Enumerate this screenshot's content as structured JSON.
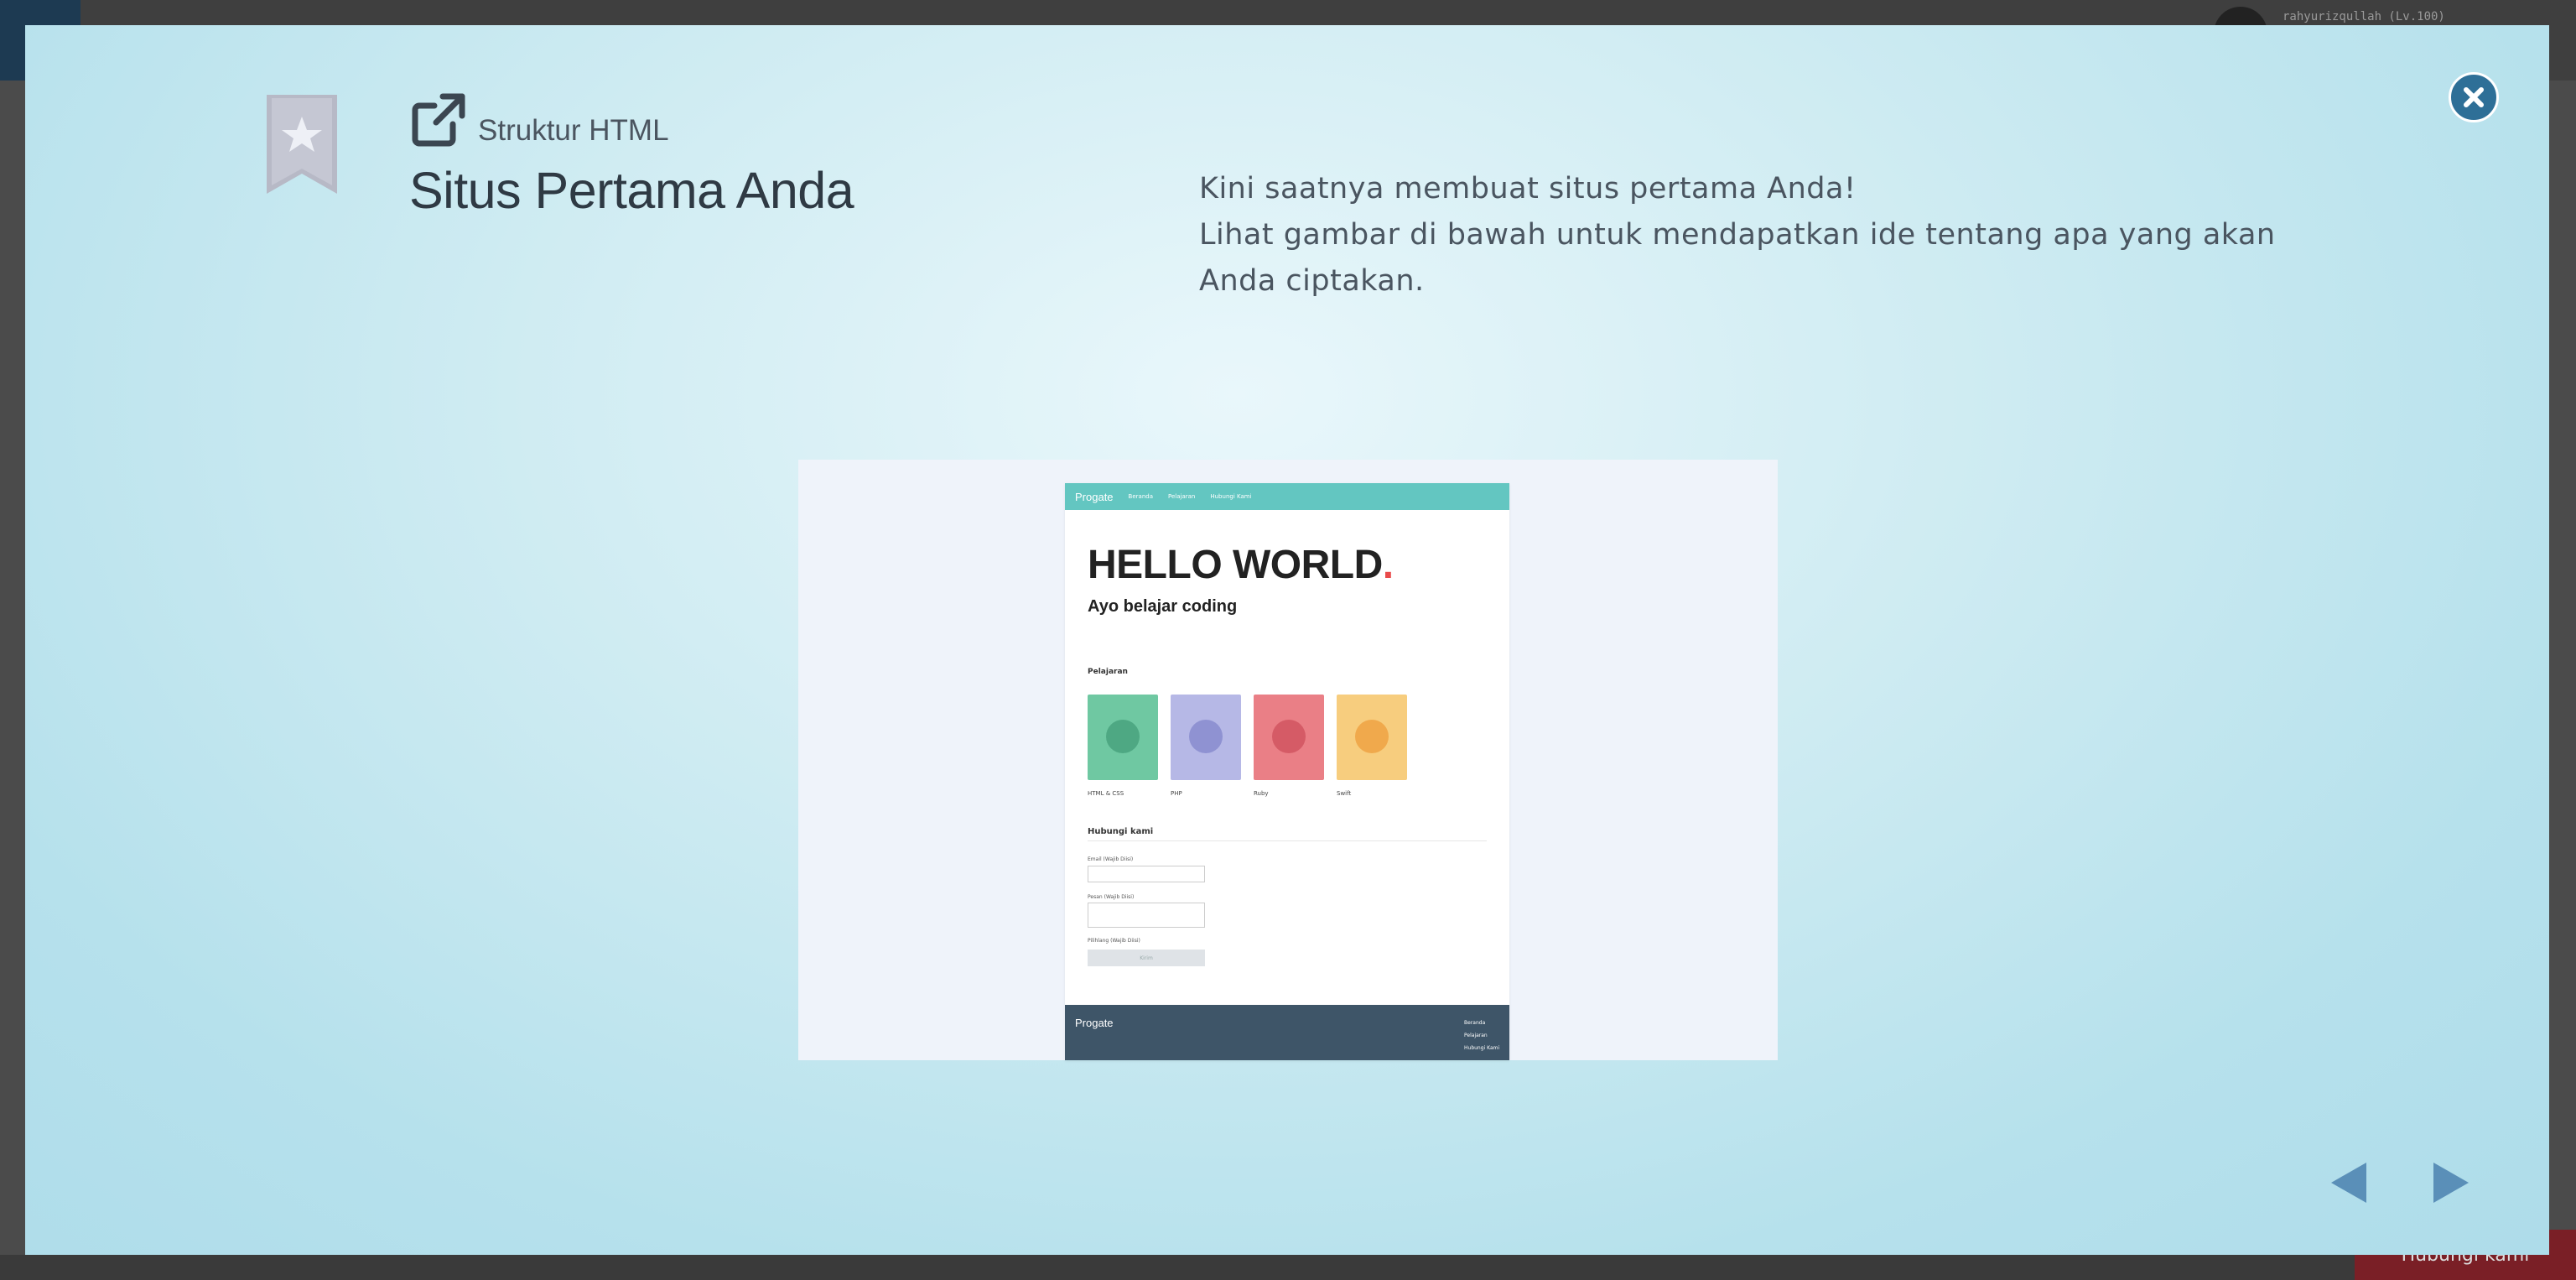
{
  "background": {
    "username": "rahyurizqullah (Lv.100)",
    "contact_button": "Hubungi kami"
  },
  "modal": {
    "subtitle": "Struktur HTML",
    "title": "Situs Pertama Anda",
    "description_line1": "Kini saatnya membuat situs pertama Anda!",
    "description_line2": "Lihat gambar di bawah untuk mendapatkan ide tentang apa yang akan Anda ciptakan.",
    "icons": {
      "bookmark": "bookmark-star-icon",
      "external": "external-link-icon",
      "close": "close-icon",
      "prev": "prev-arrow-icon",
      "next": "next-arrow-icon"
    }
  },
  "preview_site": {
    "logo": "Progate",
    "nav": [
      "Beranda",
      "Pelajaran",
      "Hubungi Kami"
    ],
    "hello": "HELLO WORLD",
    "hello_dot": ".",
    "tagline": "Ayo belajar coding",
    "lessons_heading": "Pelajaran",
    "lessons": [
      {
        "label": "HTML & CSS",
        "color": "#6fc8a2"
      },
      {
        "label": "PHP",
        "color": "#b6b8e6"
      },
      {
        "label": "Ruby",
        "color": "#ea7f86"
      },
      {
        "label": "Swift",
        "color": "#f7cd7e"
      }
    ],
    "contact_heading": "Hubungi kami",
    "fields": [
      "Email (Wajib Diisi)",
      "Pesan (Wajib Diisi)",
      "Pilihlang (Wajib Diisi)"
    ],
    "submit": "Kirim",
    "footer_logo": "Progate",
    "footer_links": [
      "Beranda",
      "Pelajaran",
      "Hubungi Kami"
    ]
  },
  "colors": {
    "accent": "#2e6f97",
    "header_teal": "#63c6c1",
    "footer_navy": "#3e5568",
    "arrow": "#5a8fb8"
  }
}
